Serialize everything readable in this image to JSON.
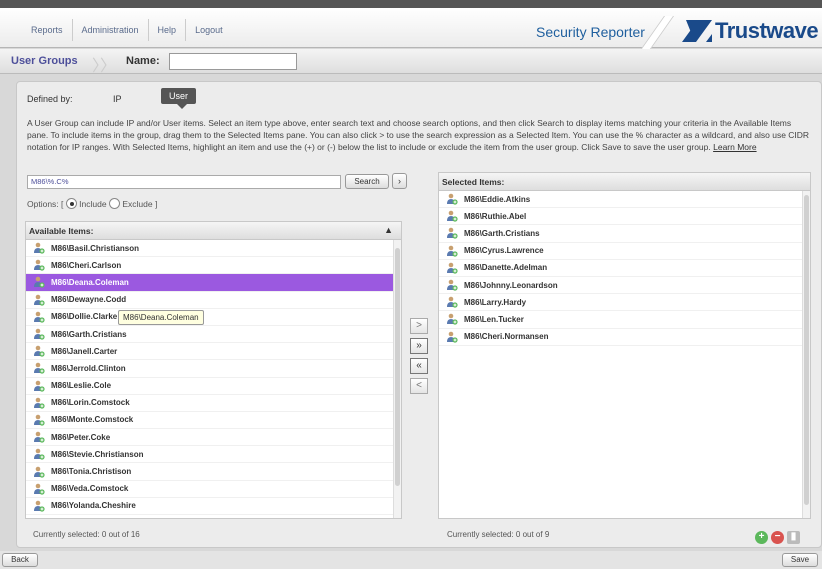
{
  "nav": [
    "Reports",
    "Administration",
    "Help",
    "Logout"
  ],
  "product": "Security Reporter",
  "brand": "Trustwave",
  "breadcrumb": {
    "section": "User Groups",
    "name_label": "Name:"
  },
  "defined_by": {
    "label": "Defined by:",
    "ip": "IP",
    "user": "User"
  },
  "description": "A User Group can include IP and/or User items. Select an item type above, enter search text and choose search options, and then click Search to display items matching your criteria in the Available Items pane. To include items in the group, drag them to the Selected Items pane. You can also click > to use the search expression as a Selected Item. You can use the % character as a wildcard, and also use CIDR notation for IP ranges. With Selected Items, highlight an item and use the (+) or (-) below the list to include or exclude the item from the user group. Click Save to save the user group.",
  "learn_more": "Learn More",
  "search": {
    "value": "M86\\%.C%",
    "button": "Search"
  },
  "options": {
    "label": "Options:",
    "include": "Include",
    "exclude": "Exclude",
    "open": "[",
    "close": "]"
  },
  "available": {
    "header": "Available Items:",
    "items": [
      "M86\\Basil.Christianson",
      "M86\\Cheri.Carlson",
      "M86\\Deana.Coleman",
      "M86\\Dewayne.Codd",
      "M86\\Dollie.Clarke",
      "M86\\Garth.Cristians",
      "M86\\Janell.Carter",
      "M86\\Jerrold.Clinton",
      "M86\\Leslie.Cole",
      "M86\\Lorin.Comstock",
      "M86\\Monte.Comstock",
      "M86\\Peter.Coke",
      "M86\\Stevie.Christianson",
      "M86\\Tonia.Christison",
      "M86\\Veda.Comstock",
      "M86\\Yolanda.Cheshire"
    ],
    "selected_index": 2,
    "footer": "Currently selected: 0 out of 16",
    "tooltip": "M86\\Deana.Coleman"
  },
  "selected": {
    "header": "Selected Items:",
    "items": [
      "M86\\Eddie.Atkins",
      "M86\\Ruthie.Abel",
      "M86\\Garth.Cristians",
      "M86\\Cyrus.Lawrence",
      "M86\\Danette.Adelman",
      "M86\\Johnny.Leonardson",
      "M86\\Larry.Hardy",
      "M86\\Len.Tucker",
      "M86\\Cheri.Normansen"
    ],
    "footer": "Currently selected: 0 out of 9"
  },
  "move_buttons": [
    ">",
    "»",
    "«",
    "<"
  ],
  "footer": {
    "back": "Back",
    "save": "Save"
  },
  "colors": {
    "selected_row": "#9b59e0",
    "brand": "#1a4a8a",
    "nav_text": "#5a6b8c",
    "add": "#5cb85c",
    "remove": "#d9534f"
  }
}
